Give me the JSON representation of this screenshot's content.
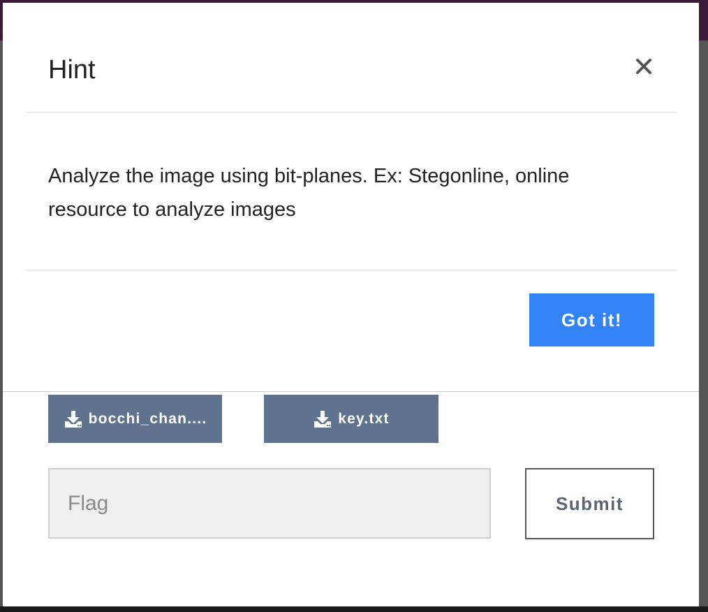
{
  "hint_modal": {
    "title": "Hint",
    "close_icon": "close-icon",
    "body_text": "Analyze the image using bit-planes. Ex: Stegonline, online resource to analyze images",
    "confirm_label": "Got it!",
    "confirm_color": "#3283f6"
  },
  "files": [
    {
      "label": "bocchi_chan....",
      "icon": "download-icon"
    },
    {
      "label": "key.txt",
      "icon": "download-icon"
    }
  ],
  "flag_form": {
    "input_value": "",
    "input_placeholder": "Flag",
    "submit_label": "Submit"
  },
  "colors": {
    "file_button": "#5f738f",
    "header_bar": "#3b1a3a"
  }
}
